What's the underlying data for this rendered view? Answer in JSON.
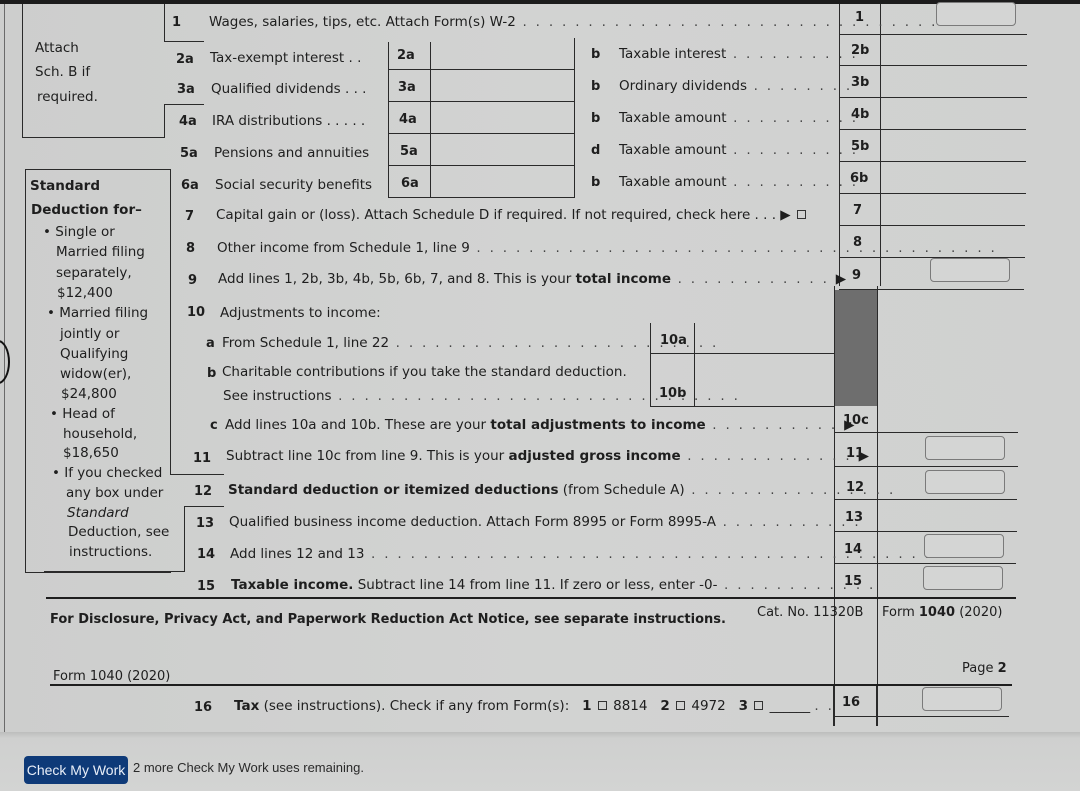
{
  "form": {
    "title": "Form 1040 (2020)",
    "sidebar_attach": [
      "Attach",
      "Sch. B if",
      "required."
    ],
    "standard_deduction": {
      "heading1": "Standard",
      "heading2": "Deduction for–",
      "lines": [
        "• Single or",
        "Married filing",
        "separately,",
        "$12,400",
        "• Married filing",
        "jointly or",
        "Qualifying",
        "widow(er),",
        "$24,800",
        "• Head of",
        "household,",
        "$18,650",
        "• If you checked",
        "any box under",
        "Standard",
        "Deduction, see",
        "instructions."
      ]
    },
    "lines": {
      "l1": {
        "num": "1",
        "text": "Wages, salaries, tips, etc. Attach Form(s) W-2",
        "box": "1"
      },
      "l2a": {
        "num": "2a",
        "text": "Tax-exempt interest . .",
        "box": "2a"
      },
      "l2b": {
        "num": "b",
        "text": "Taxable interest",
        "box": "2b"
      },
      "l3a": {
        "num": "3a",
        "text": "Qualified dividends . . .",
        "box": "3a"
      },
      "l3b": {
        "num": "b",
        "text": "Ordinary dividends",
        "box": "3b"
      },
      "l4a": {
        "num": "4a",
        "text": "IRA distributions . . . . .",
        "box": "4a"
      },
      "l4b": {
        "num": "b",
        "text": "Taxable amount",
        "box": "4b"
      },
      "l5a": {
        "num": "5a",
        "text": "Pensions and annuities",
        "box": "5a"
      },
      "l5b": {
        "num": "d",
        "text": "Taxable amount",
        "box": "5b"
      },
      "l6a": {
        "num": "6a",
        "text": "Social security benefits",
        "box": "6a"
      },
      "l6b": {
        "num": "b",
        "text": "Taxable amount",
        "box": "6b"
      },
      "l7": {
        "num": "7",
        "text": "Capital gain or (loss). Attach Schedule D if required. If not required, check here . . . ▶",
        "box": "7"
      },
      "l8": {
        "num": "8",
        "text": "Other income from Schedule 1, line 9",
        "box": "8"
      },
      "l9": {
        "num": "9",
        "text_pre": "Add lines 1, 2b, 3b, 4b, 5b, 6b, 7, and 8. This is your ",
        "text_bold": "total income",
        "box": "9"
      },
      "l10": {
        "num": "10",
        "text": "Adjustments to income:"
      },
      "l10a": {
        "num": "a",
        "text": "From Schedule 1, line 22",
        "box": "10a"
      },
      "l10b": {
        "num": "b",
        "text": "Charitable contributions if you take the standard deduction.",
        "text2": "See instructions",
        "box": "10b"
      },
      "l10c": {
        "num": "c",
        "text_pre": "Add lines 10a and 10b. These are your ",
        "text_bold": "total adjustments to income",
        "box": "10c"
      },
      "l11": {
        "num": "11",
        "text_pre": "Subtract line 10c from line 9. This is your ",
        "text_bold": "adjusted gross income",
        "box": "11"
      },
      "l12": {
        "num": "12",
        "text_bold": "Standard deduction or itemized deductions",
        "text_post": " (from Schedule A)",
        "box": "12"
      },
      "l13": {
        "num": "13",
        "text": "Qualified business income deduction. Attach Form 8995 or Form 8995-A",
        "box": "13"
      },
      "l14": {
        "num": "14",
        "text": "Add lines 12 and 13",
        "box": "14"
      },
      "l15": {
        "num": "15",
        "text_bold": "Taxable income.",
        "text_post": " Subtract line 14 from line 11. If zero or less, enter -0-",
        "box": "15"
      },
      "l16": {
        "num": "16",
        "text_bold": "Tax",
        "text_post": " (see instructions). Check if any from Form(s):",
        "opt1_num": "1",
        "opt1": "8814",
        "opt2_num": "2",
        "opt2": "4972",
        "opt3_num": "3",
        "box": "16"
      }
    },
    "inputs": {
      "line1": "",
      "line9": "",
      "line11": "",
      "line12": "",
      "line14": "",
      "line15": "",
      "line16": ""
    },
    "footer": {
      "notice": "For Disclosure, Privacy Act, and Paperwork Reduction Act Notice, see separate instructions.",
      "cat_no": "Cat. No. 11320B",
      "form_pre": "Form ",
      "form_bold": "1040",
      "form_year": " (2020)"
    },
    "page2": {
      "label": "Form 1040 (2020)",
      "page_pre": "Page ",
      "page_num": "2"
    }
  },
  "bottom": {
    "check_button": "Check My Work",
    "remaining": "2 more Check My Work uses remaining."
  },
  "colors": {
    "button_bg": "#0e3a78",
    "shaded_cell": "#6e6e6e"
  }
}
